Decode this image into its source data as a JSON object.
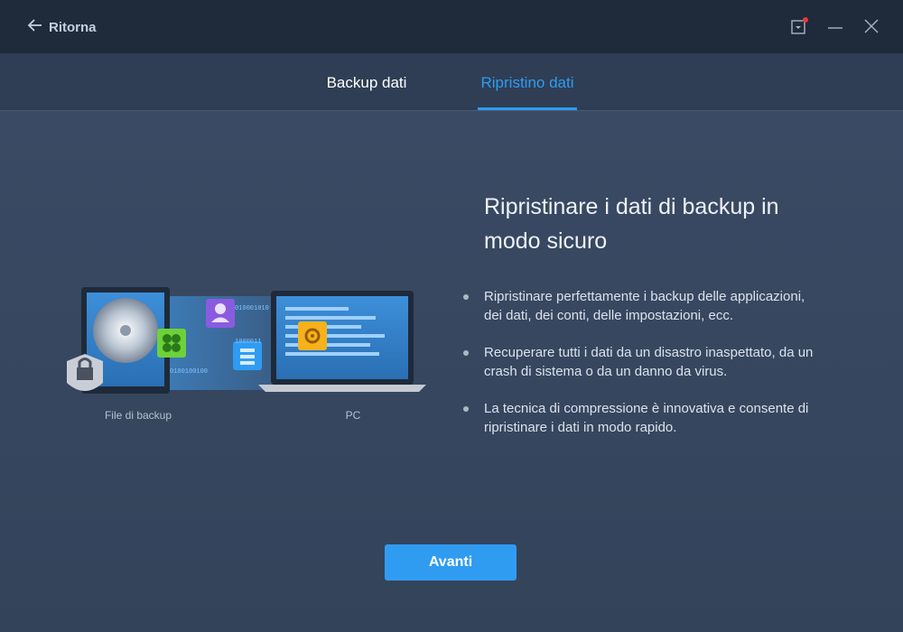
{
  "titlebar": {
    "back_label": "Ritorna",
    "icons": [
      "arrow-left-icon",
      "notification-icon",
      "minimize-icon",
      "close-icon"
    ],
    "notification_dot_color": "#e53935"
  },
  "tabs": [
    {
      "label": "Backup dati",
      "active": false
    },
    {
      "label": "Ripristino dati",
      "active": true
    }
  ],
  "illustration": {
    "source_label": "File di backup",
    "target_label": "PC",
    "binary_texts": [
      "010001010",
      "1000011",
      "0100100100"
    ]
  },
  "main": {
    "heading": "Ripristinare i dati di backup in modo sicuro",
    "bullets": [
      "Ripristinare perfettamente i backup delle applicazioni, dei dati, dei conti, delle impostazioni, ecc.",
      "Recuperare tutti i dati da un disastro inaspettato, da un crash di sistema o da un danno da virus.",
      "La tecnica di compressione è innovativa e consente di ripristinare i dati in modo rapido."
    ]
  },
  "footer": {
    "next_label": "Avanti"
  },
  "colors": {
    "accent": "#2f9cf2",
    "titlebar_bg": "#1f2a3b",
    "content_bg": "#34445c"
  }
}
